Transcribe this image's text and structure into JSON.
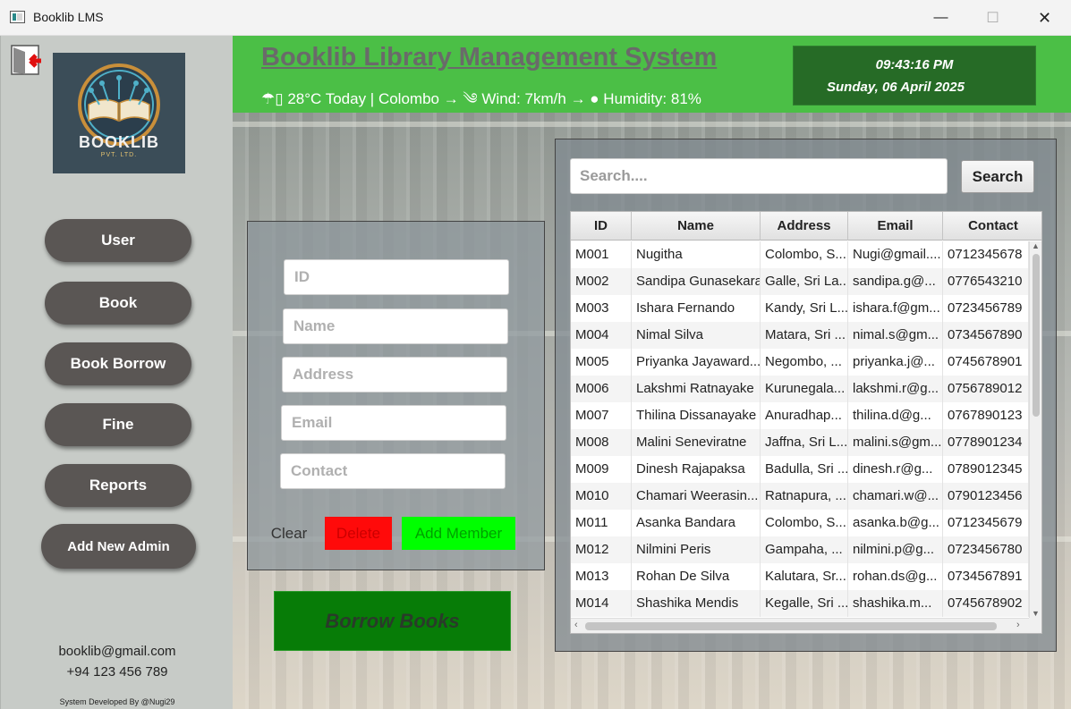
{
  "window": {
    "title": "Booklib LMS",
    "minimize": "—",
    "maximize": "☐",
    "close": "✕"
  },
  "sidebar": {
    "logo_text": "BOOKLIB",
    "logo_sub": "PVT. LTD.",
    "nav": {
      "user": "User",
      "book": "Book",
      "book_borrow": "Book Borrow",
      "fine": "Fine",
      "reports": "Reports",
      "add_admin": "Add New Admin"
    },
    "email": "booklib@gmail.com",
    "phone": "+94 123 456 789",
    "developer": "System Developed By @Nugi29"
  },
  "header": {
    "title": "Booklib Library Management System",
    "weather": "☂▯ 28°C Today | Colombo → ༄ Wind: 7km/h → ● Humidity: 81%",
    "time": "09:43:16 PM",
    "date": "Sunday, 06 April 2025"
  },
  "form": {
    "id_placeholder": "ID",
    "name_placeholder": "Name",
    "address_placeholder": "Address",
    "email_placeholder": "Email",
    "contact_placeholder": "Contact",
    "clear": "Clear",
    "delete": "Delete",
    "add_member": "Add Member"
  },
  "borrow_button": "Borrow Books",
  "search": {
    "placeholder": "Search....",
    "button": "Search"
  },
  "table": {
    "columns": [
      "ID",
      "Name",
      "Address",
      "Email",
      "Contact"
    ],
    "rows": [
      [
        "M001",
        "Nugitha",
        "Colombo, S...",
        "Nugi@gmail....",
        "0712345678"
      ],
      [
        "M002",
        "Sandipa Gunasekara",
        "Galle, Sri La...",
        "sandipa.g@...",
        "0776543210"
      ],
      [
        "M003",
        "Ishara Fernando",
        "Kandy, Sri L...",
        "ishara.f@gm...",
        "0723456789"
      ],
      [
        "M004",
        "Nimal Silva",
        "Matara, Sri ...",
        "nimal.s@gm...",
        "0734567890"
      ],
      [
        "M005",
        "Priyanka Jayaward...",
        "Negombo, ...",
        "priyanka.j@...",
        "0745678901"
      ],
      [
        "M006",
        "Lakshmi Ratnayake",
        "Kurunegala...",
        "lakshmi.r@g...",
        "0756789012"
      ],
      [
        "M007",
        "Thilina Dissanayake",
        "Anuradhap...",
        "thilina.d@g...",
        "0767890123"
      ],
      [
        "M008",
        "Malini Seneviratne",
        "Jaffna, Sri L...",
        "malini.s@gm...",
        "0778901234"
      ],
      [
        "M009",
        "Dinesh Rajapaksa",
        "Badulla, Sri ...",
        "dinesh.r@g...",
        "0789012345"
      ],
      [
        "M010",
        "Chamari Weerasin...",
        "Ratnapura, ...",
        "chamari.w@...",
        "0790123456"
      ],
      [
        "M011",
        "Asanka Bandara",
        "Colombo, S...",
        "asanka.b@g...",
        "0712345679"
      ],
      [
        "M012",
        "Nilmini Peris",
        "Gampaha, ...",
        "nilmini.p@g...",
        "0723456780"
      ],
      [
        "M013",
        "Rohan De Silva",
        "Kalutara, Sr...",
        "rohan.ds@g...",
        "0734567891"
      ],
      [
        "M014",
        "Shashika Mendis",
        "Kegalle, Sri ...",
        "shashika.m...",
        "0745678902"
      ]
    ]
  },
  "colors": {
    "header_green": "#4bbf46",
    "clock_green": "#266b26",
    "borrow_green": "#077c07",
    "nav_button": "#5a5654",
    "sidebar_bg": "#c7cbc7",
    "delete_red": "#ff0a0a",
    "add_green": "#00ff00"
  },
  "icons": {
    "logout": "logout-door-arrow-icon",
    "logo": "book-circuit-logo-icon"
  }
}
